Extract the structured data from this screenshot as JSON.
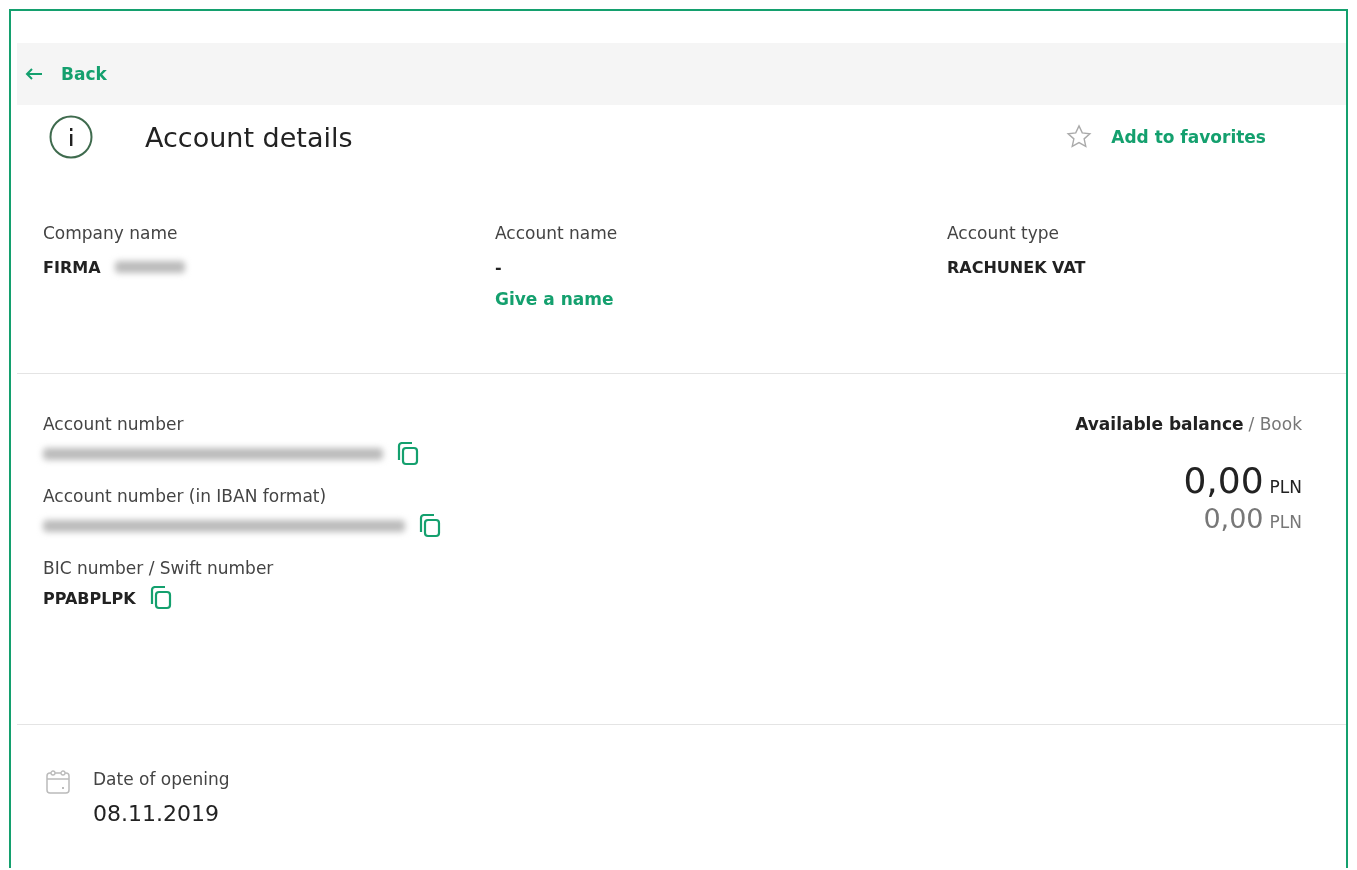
{
  "back_link": {
    "label": "Back"
  },
  "header": {
    "title": "Account details",
    "favorite": {
      "label": "Add to favorites",
      "selected": false
    }
  },
  "summary_fields": [
    {
      "label": "Company name",
      "value": "FIRMA",
      "redacted": true
    },
    {
      "label": "Account name",
      "value": "-",
      "action": "Give a name"
    },
    {
      "label": "Account type",
      "value": "RACHUNEK VAT"
    }
  ],
  "number_fields": [
    {
      "label": "Account number",
      "redacted": true,
      "copyable": true
    },
    {
      "label": "Account number (in IBAN format)",
      "redacted": true,
      "copyable": true
    },
    {
      "label": "BIC number / Swift number",
      "value": "PPABPLPK",
      "copyable": true
    }
  ],
  "balance": {
    "available_label": "Available balance",
    "book_label": "/ Book",
    "available": {
      "amount": "0,00",
      "currency": "PLN"
    },
    "book": {
      "amount": "0,00",
      "currency": "PLN"
    }
  },
  "opening": {
    "label": "Date of opening",
    "value": "08.11.2019"
  }
}
